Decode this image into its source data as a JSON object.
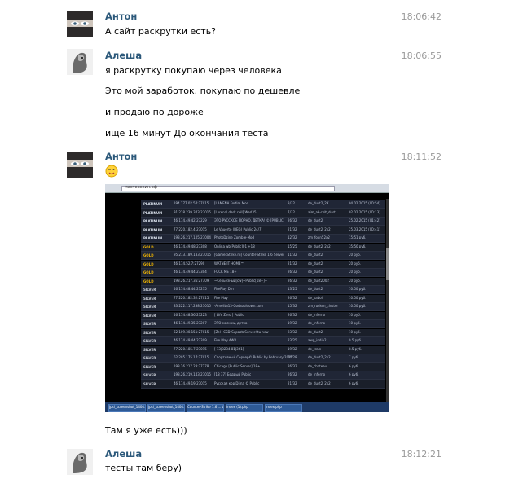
{
  "messages": [
    {
      "author": "Антон",
      "time": "18:06:42",
      "lines": [
        "А сайт раскрутки есть?"
      ]
    },
    {
      "author": "Алеша",
      "time": "18:06:55",
      "lines": [
        "я раскрутку покупаю через человека",
        "Это мой заработок. покупаю по дешевле",
        "и продаю по дороже",
        "ище 16 минут До окончания теста"
      ]
    },
    {
      "author": "Антон",
      "time": "18:11:52",
      "emoji": "wink-smiley-icon",
      "lines": [
        "Там я уже есть)))"
      ]
    },
    {
      "author": "Алеша",
      "time": "18:12:21",
      "lines": [
        "тесты там беру)"
      ]
    }
  ],
  "screenshot": {
    "address": "мастерскин.рф",
    "rows": [
      {
        "badge": "PLATINUM",
        "ip": "194.177.02.54:27015",
        "name": "[LAMENA Fortim Mod",
        "players": "3/32",
        "map": "de_dust2_2K",
        "price": "04.02.2015 (00:54)"
      },
      {
        "badge": "PLATINUM",
        "ip": "91.218.239.343:27015",
        "name": "[Lorenal dark cell] Warl35",
        "players": "7/32",
        "map": "aim_ak-colt_dust",
        "price": "02.02.2015 (00:13)"
      },
      {
        "badge": "PLATINUM",
        "ip": "46.174.49.42:27229",
        "name": "ЭТО РУССКОЕ ПОРНО, ДЕТКА! © [PUBLIC]",
        "players": "26/32",
        "map": "de_dust2",
        "price": "25.02.2015 (01:42)"
      },
      {
        "badge": "PLATINUM",
        "ip": "77.220.182.4:27015",
        "name": "Le Vauerto (BEG) Public 24/7",
        "players": "21/32",
        "map": "de_dust2_2x2",
        "price": "25.03.2015 (00:41)"
      },
      {
        "badge": "PLATINUM",
        "ip": "193.26.217.105:27004",
        "name": "PhotoDzine Zombie-Mod",
        "players": "12/32",
        "map": "zm_foun52x2",
        "price": "15:51 руб."
      },
      {
        "badge": "GOLD",
        "ip": "46.174.49.48:27308",
        "name": "Onlina wb[Public]01 +18",
        "players": "15/25",
        "map": "de_dust2_2x2",
        "price": "35:50 руб."
      },
      {
        "badge": "GOLD",
        "ip": "95.213.189.183:27015",
        "name": "[GamesStrike.ru] Counter-Strike 1.6 Server",
        "players": "11/32",
        "map": "de_dust2",
        "price": "20 руб."
      },
      {
        "badge": "GOLD",
        "ip": "46.174.52.7:27290",
        "name": "WATNE IT HOME™",
        "players": "21/32",
        "map": "de_dust2",
        "price": "20 руб."
      },
      {
        "badge": "GOLD",
        "ip": "46.174.49.44:27304",
        "name": "FUCK ME 18+",
        "players": "26/32",
        "map": "de_dust2",
        "price": "20 руб."
      },
      {
        "badge": "GOLD",
        "ip": "193.26.217.35:27309",
        "name": "~Серьёзный[cw]~Public[18+]~",
        "players": "26/32",
        "map": "de_dust2002",
        "price": "20 руб."
      },
      {
        "badge": "SILVER",
        "ip": "46.174.48.44:27215",
        "name": "FirePlay Dm",
        "players": "13/25",
        "map": "de_dust2",
        "price": "10.50 руб."
      },
      {
        "badge": "SILVER",
        "ip": "77.220.182.32:27015",
        "name": "Fire Play",
        "players": "26/32",
        "map": "de_kabol",
        "price": "10.50 руб."
      },
      {
        "badge": "SILVER",
        "ip": "83.222.117.238:27015",
        "name": "-Amelita13-Godsouldown.com",
        "players": "15/32",
        "map": "zm_rucken_zinster",
        "price": "10.50 руб."
      },
      {
        "badge": "SILVER",
        "ip": "46.174.48.36:27223",
        "name": "[ Life Zero ] Public",
        "players": "26/32",
        "map": "de_inferno",
        "price": "10 руб."
      },
      {
        "badge": "SILVER",
        "ip": "46.174.49.35:27207",
        "name": "ЭТО москоw, детка",
        "players": "19/32",
        "map": "de_inferno",
        "price": "10 руб."
      },
      {
        "badge": "SILVER",
        "ip": "62.109.30.151:27015",
        "name": "[Zel+CSD]SupastaServer4tu new",
        "players": "23/32",
        "map": "de_dust2",
        "price": "10 руб."
      },
      {
        "badge": "SILVER",
        "ip": "46.174.49.44:27309",
        "name": "Fire Play AWP",
        "players": "23/25",
        "map": "awp_india2",
        "price": "9.5 руб."
      },
      {
        "badge": "SILVER",
        "ip": "77.220.185.7:27015",
        "name": "[ 13|3234 81|361]",
        "players": "19/32",
        "map": "de_train",
        "price": "8.5 руб."
      },
      {
        "badge": "SILVER",
        "ip": "62.205.175.17:27015",
        "name": "Спортивный Сервер© Public by February 2015",
        "players": "16/28",
        "map": "de_dust2_2x2",
        "price": "7 руб."
      },
      {
        "badge": "SILVER",
        "ip": "193.26.217.28:27278",
        "name": "Chicago [Public Server] 18+",
        "players": "26/32",
        "map": "de_chateau",
        "price": "6 руб."
      },
      {
        "badge": "SILVER",
        "ip": "193.26.219.143:27015",
        "name": "[18 37] Бодрый Public",
        "players": "26/32",
        "map": "de_inferno",
        "price": "6 руб."
      },
      {
        "badge": "SILVER",
        "ip": "46.174.49.19:27015",
        "name": "Русская кор Dima © Public",
        "players": "21/32",
        "map": "de_dust2_2x2",
        "price": "6 руб."
      }
    ],
    "taskbar": [
      "jpsi_screenshot_1404...png",
      "jpsi_screenshot_1404...png",
      "Counter-Strike 1.6 ... torrent",
      "index (1).php",
      "index.php"
    ]
  }
}
